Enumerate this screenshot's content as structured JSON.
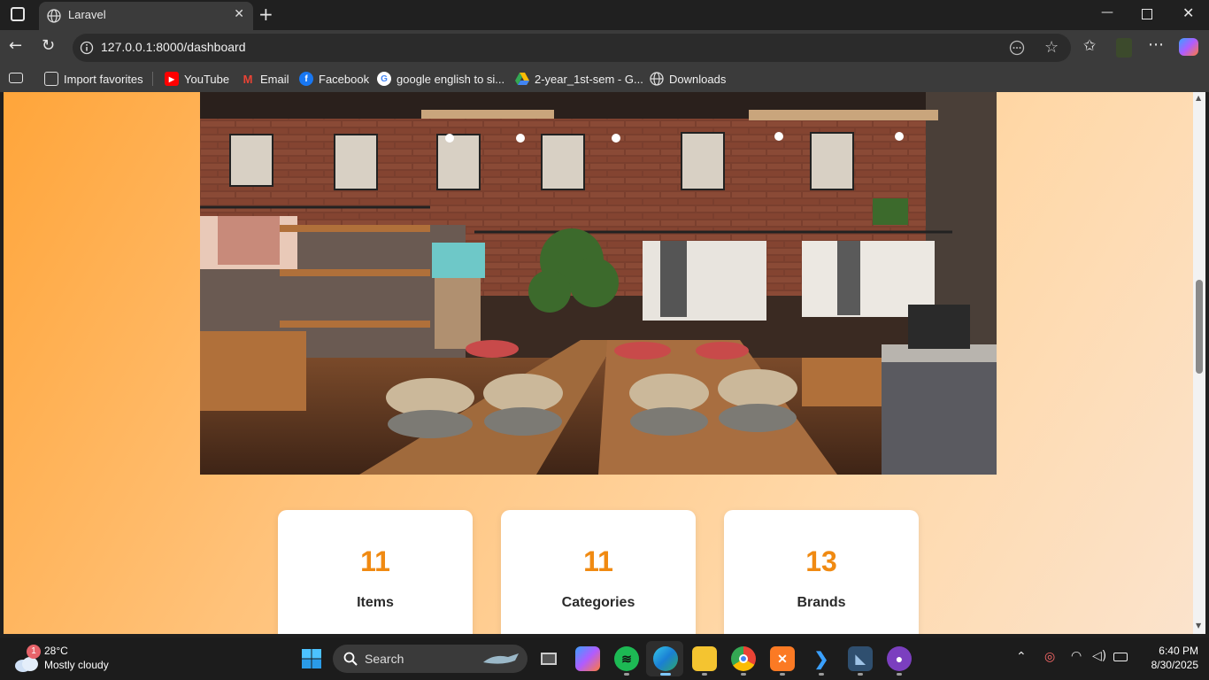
{
  "browser": {
    "tab_title": "Laravel",
    "url": "127.0.0.1:8000/dashboard",
    "favorites": [
      {
        "label": "Import favorites",
        "icon": "import-icon"
      },
      {
        "label": "YouTube",
        "icon": "youtube-icon"
      },
      {
        "label": "Email",
        "icon": "gmail-icon"
      },
      {
        "label": "Facebook",
        "icon": "facebook-icon"
      },
      {
        "label": "google english to si...",
        "icon": "google-icon"
      },
      {
        "label": "2-year_1st-sem - G...",
        "icon": "drive-icon"
      },
      {
        "label": "Downloads",
        "icon": "globe-icon"
      }
    ]
  },
  "dashboard": {
    "stats": [
      {
        "value": "11",
        "label": "Items"
      },
      {
        "value": "11",
        "label": "Categories"
      },
      {
        "value": "13",
        "label": "Brands"
      }
    ],
    "accent_color": "#f08a12"
  },
  "taskbar": {
    "weather_badge": "1",
    "temperature": "28°C",
    "condition": "Mostly cloudy",
    "search_placeholder": "Search",
    "time": "6:40 PM",
    "date": "8/30/2025"
  }
}
